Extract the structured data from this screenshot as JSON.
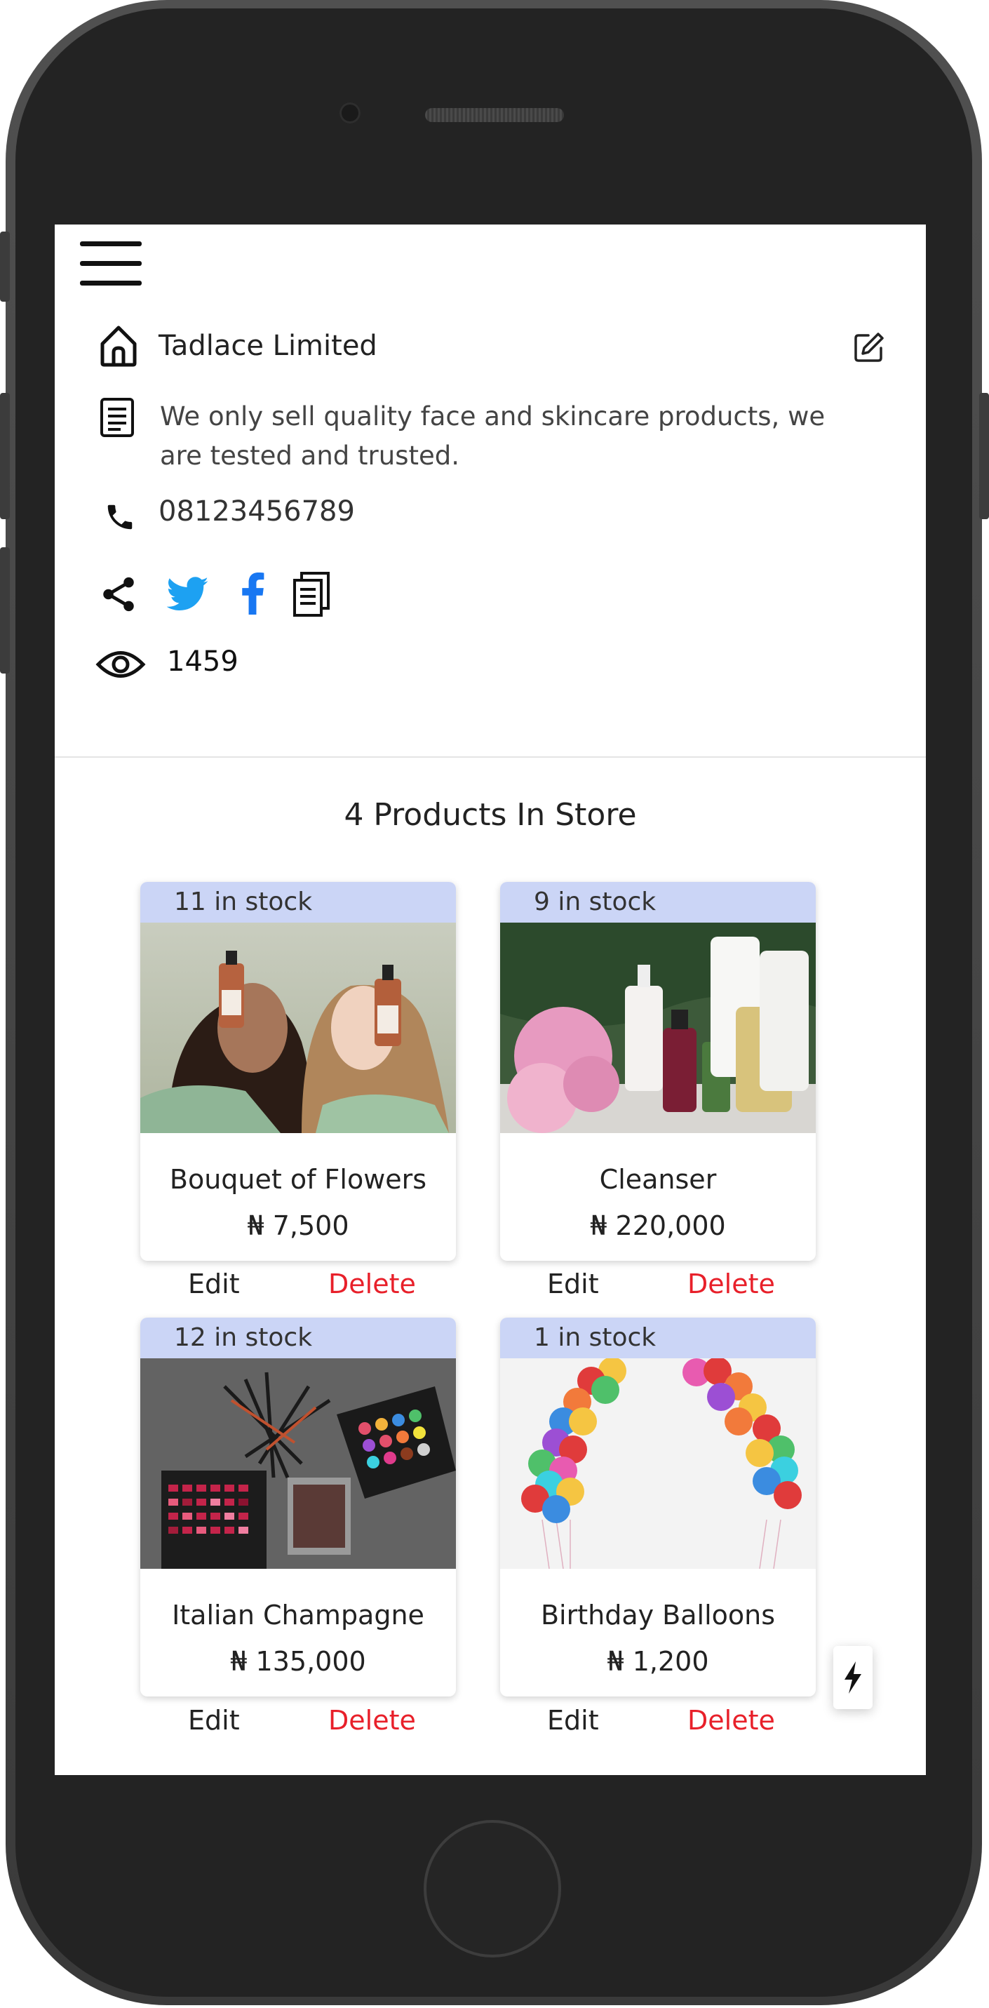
{
  "store": {
    "name": "Tadlace Limited",
    "description": "We only sell quality face and skincare products, we are tested and trusted.",
    "phone": "08123456789",
    "views": "1459"
  },
  "icons": {
    "menu": "hamburger-menu-icon",
    "home": "home-icon",
    "edit": "edit-icon",
    "description": "document-icon",
    "phone": "phone-icon",
    "share": "share-icon",
    "twitter": "twitter-icon",
    "facebook": "facebook-icon",
    "copy": "copy-icon",
    "views": "eye-icon",
    "flash": "lightning-icon"
  },
  "colors": {
    "stock_bar": "#cbd5f6",
    "delete": "#e8202a",
    "twitter": "#1da1f2",
    "facebook": "#1877f2"
  },
  "products_title": "4 Products In Store",
  "products": [
    {
      "stock": "11 in stock",
      "name": "Bouquet of Flowers",
      "price": "₦ 7,500",
      "edit": "Edit",
      "delete": "Delete",
      "image": "two women holding skincare serum bottles"
    },
    {
      "stock": "9 in stock",
      "name": "Cleanser",
      "price": "₦ 220,000",
      "edit": "Edit",
      "delete": "Delete",
      "image": "skincare bottles with pink peonies"
    },
    {
      "stock": "12 in stock",
      "name": "Italian Champagne",
      "price": "₦ 135,000",
      "edit": "Edit",
      "delete": "Delete",
      "image": "makeup palettes and brushes on wood"
    },
    {
      "stock": "1 in stock",
      "name": "Birthday Balloons",
      "price": "₦ 1,200",
      "edit": "Edit",
      "delete": "Delete",
      "image": "colorful balloon arches"
    }
  ]
}
